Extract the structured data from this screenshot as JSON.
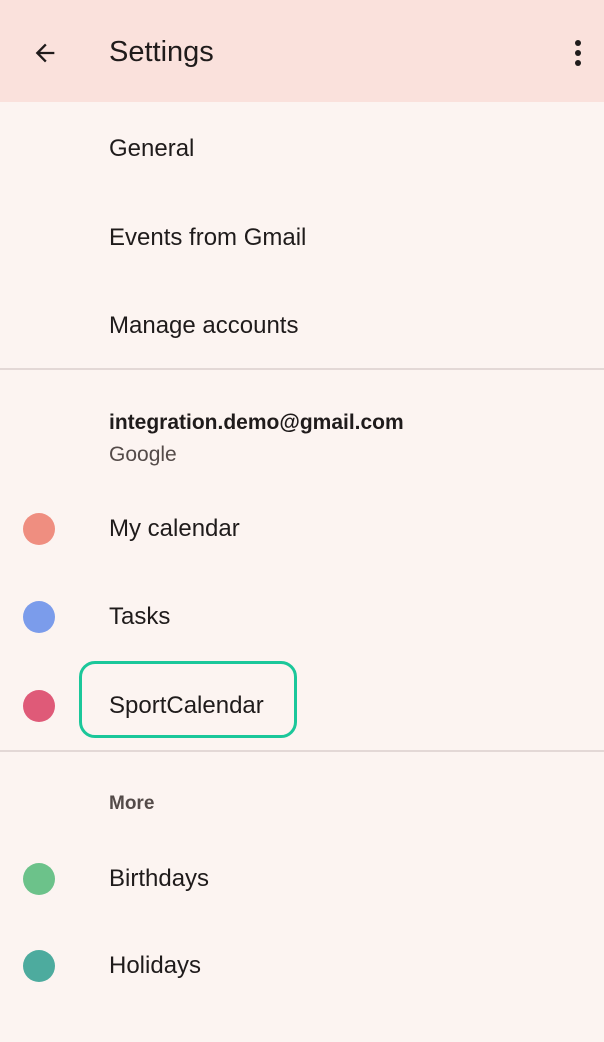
{
  "app_bar": {
    "title": "Settings"
  },
  "menu": {
    "general": "General",
    "events_from_gmail": "Events from Gmail",
    "manage_accounts": "Manage accounts"
  },
  "account": {
    "email": "integration.demo@gmail.com",
    "type": "Google",
    "calendars": [
      {
        "label": "My calendar",
        "color": "#ef8e80"
      },
      {
        "label": "Tasks",
        "color": "#7b9ceb"
      },
      {
        "label": "SportCalendar",
        "color": "#df5a78"
      }
    ]
  },
  "more": {
    "header": "More",
    "calendars": [
      {
        "label": "Birthdays",
        "color": "#6cc28a"
      },
      {
        "label": "Holidays",
        "color": "#4dab9e"
      }
    ]
  },
  "colors": {
    "app_bar_bg": "#fae1dc",
    "page_bg": "#fcf4f1",
    "highlight": "#1bc79a"
  },
  "icons": {
    "back": "arrow-back-icon",
    "overflow": "more-vert-icon"
  }
}
